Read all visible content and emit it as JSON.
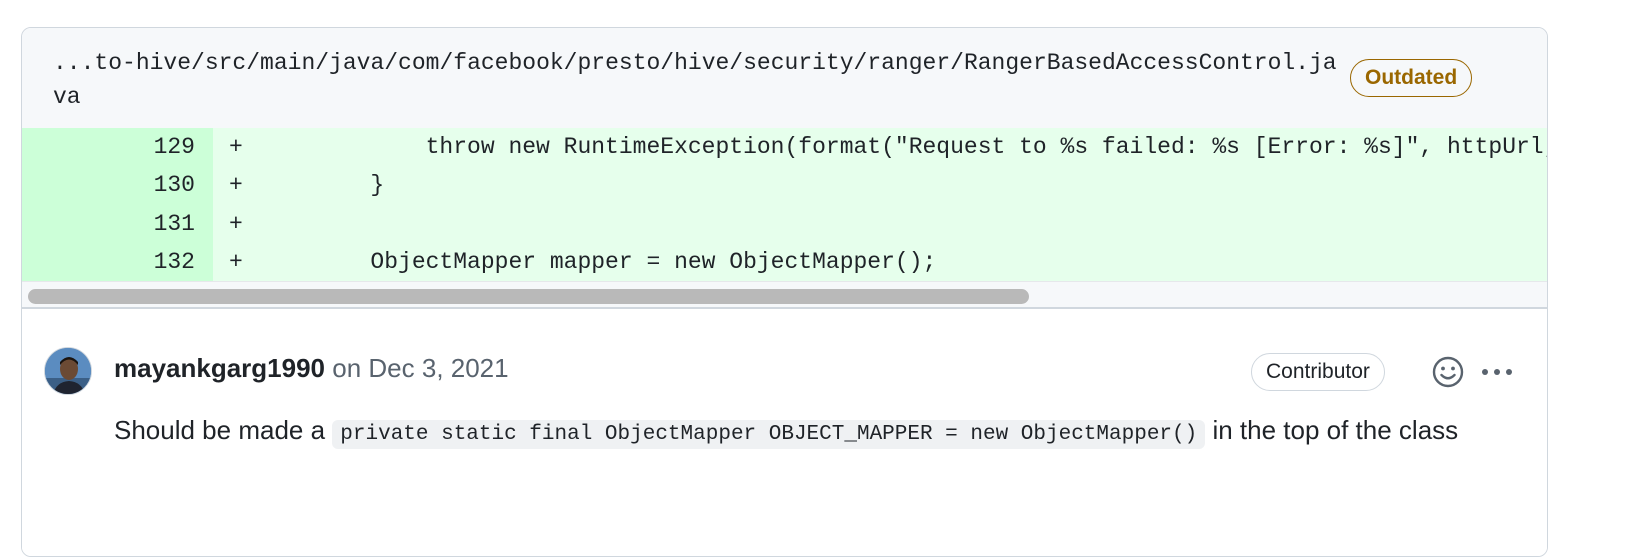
{
  "file_header": {
    "path": "...to-hive/src/main/java/com/facebook/presto/hive/security/ranger/RangerBasedAccessControl.java",
    "badge": "Outdated"
  },
  "diff": {
    "rows": [
      {
        "line": "129",
        "sign": "+",
        "code": "            throw new RuntimeException(format(\"Request to %s failed: %s [Error: %s]\", httpUrl,"
      },
      {
        "line": "130",
        "sign": "+",
        "code": "        }"
      },
      {
        "line": "131",
        "sign": "+",
        "code": ""
      },
      {
        "line": "132",
        "sign": "+",
        "code": "        ObjectMapper mapper = new ObjectMapper();"
      }
    ]
  },
  "comment": {
    "author": "mayankgarg1990",
    "date_prefix": " on Dec 3, 2021",
    "badge": "Contributor",
    "body_before": "Should be made a ",
    "body_code": "private static final ObjectMapper OBJECT_MAPPER = new ObjectMapper()",
    "body_after": " in the top of the class",
    "icons": {
      "reaction": "smiley-icon",
      "more": "kebab-horizontal-icon"
    }
  },
  "colors": {
    "added_bg": "#e6ffec",
    "added_gutter": "#ccffd8",
    "outdated": "#9a6700",
    "border": "#d0d7de"
  }
}
